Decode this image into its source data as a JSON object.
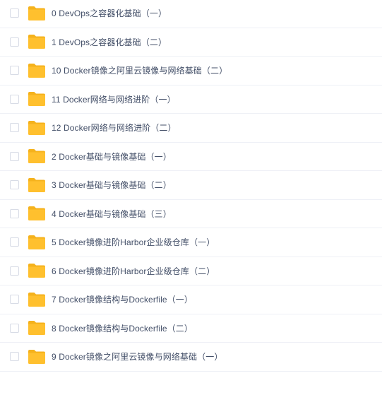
{
  "colors": {
    "folder": "#ffc02e",
    "folder_tab": "#f5b21c",
    "text": "#424e67",
    "divider": "#eef0f6",
    "checkbox_border": "#d8dce6"
  },
  "file_list": {
    "items": [
      {
        "name": "0 DevOps之容器化基础（一）",
        "icon": "folder-icon"
      },
      {
        "name": "1 DevOps之容器化基础（二）",
        "icon": "folder-icon"
      },
      {
        "name": "10 Docker镜像之阿里云镜像与网络基础（二）",
        "icon": "folder-icon"
      },
      {
        "name": "11 Docker网络与网络进阶（一）",
        "icon": "folder-icon"
      },
      {
        "name": "12 Docker网络与网络进阶（二）",
        "icon": "folder-icon"
      },
      {
        "name": "2 Docker基础与镜像基础（一）",
        "icon": "folder-icon"
      },
      {
        "name": "3 Docker基础与镜像基础（二）",
        "icon": "folder-icon"
      },
      {
        "name": "4 Docker基础与镜像基础（三）",
        "icon": "folder-icon"
      },
      {
        "name": "5 Docker镜像进阶Harbor企业级仓库（一）",
        "icon": "folder-icon"
      },
      {
        "name": "6 Docker镜像进阶Harbor企业级仓库（二）",
        "icon": "folder-icon"
      },
      {
        "name": "7 Docker镜像结构与Dockerfile（一）",
        "icon": "folder-icon"
      },
      {
        "name": "8 Docker镜像结构与Dockerfile（二）",
        "icon": "folder-icon"
      },
      {
        "name": "9 Docker镜像之阿里云镜像与网络基础（一）",
        "icon": "folder-icon"
      }
    ]
  }
}
